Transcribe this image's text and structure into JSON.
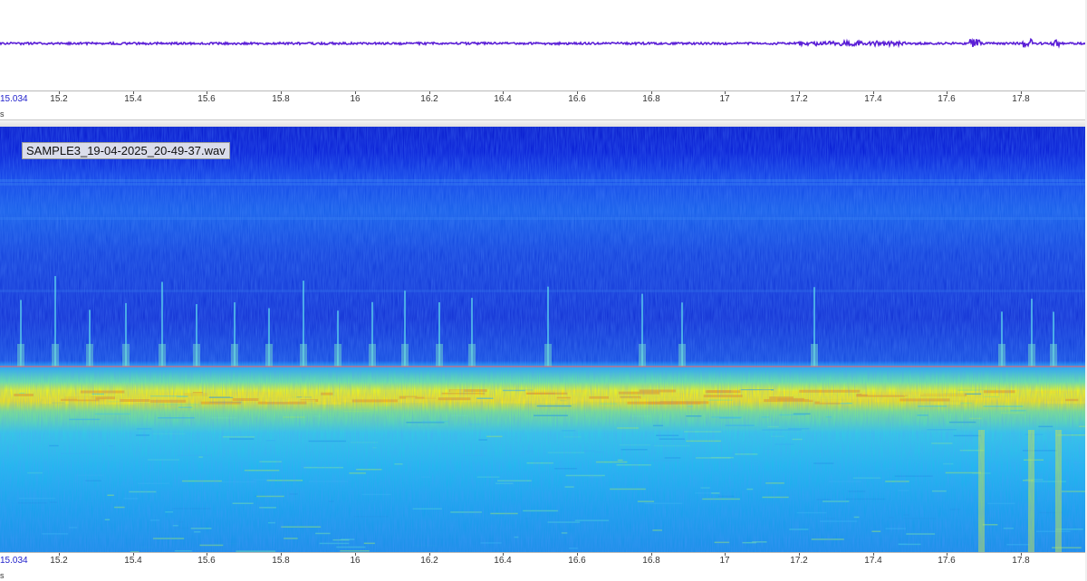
{
  "file_name": "SAMPLE3_19-04-2025_20-49-37.wav",
  "time_axis": {
    "start_label": "15.034",
    "unit": "s",
    "ticks": [
      "15.2",
      "15.4",
      "15.6",
      "15.8",
      "16",
      "16.2",
      "16.4",
      "16.6",
      "16.8",
      "17",
      "17.2",
      "17.4",
      "17.6",
      "17.8"
    ]
  },
  "colors": {
    "waveform": "#5b1fd6",
    "cursor_line": "#ff5a5a",
    "spectrogram_low": "#0a1fb8",
    "spectrogram_mid": "#19a8f0",
    "spectrogram_high": "#f2f21a"
  }
}
